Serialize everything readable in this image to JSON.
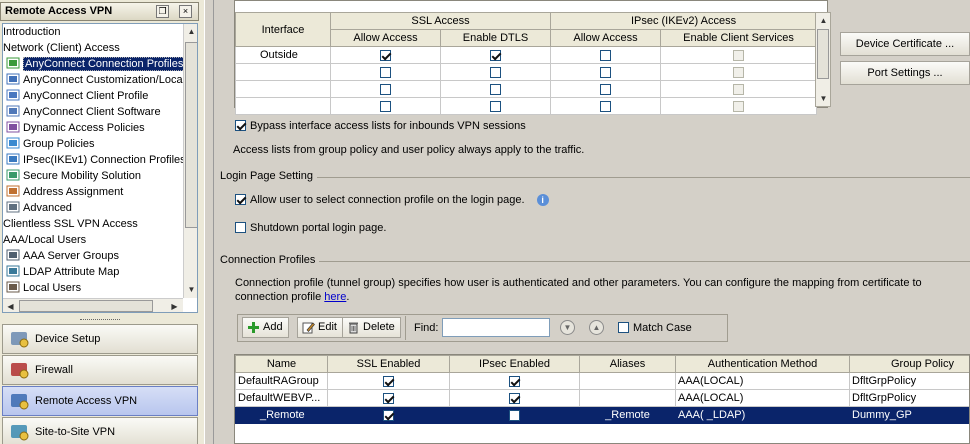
{
  "left": {
    "title": "Remote Access VPN",
    "tree": [
      {
        "label": "Introduction",
        "sub": false
      },
      {
        "label": "Network (Client) Access",
        "sub": false
      },
      {
        "label": "AnyConnect Connection Profiles",
        "sub": true,
        "icon": "profile-icon",
        "selected": true
      },
      {
        "label": "AnyConnect Customization/Localization",
        "sub": true,
        "icon": "customization-icon"
      },
      {
        "label": "AnyConnect Client Profile",
        "sub": true,
        "icon": "client-profile-icon"
      },
      {
        "label": "AnyConnect Client Software",
        "sub": true,
        "icon": "client-software-icon"
      },
      {
        "label": "Dynamic Access Policies",
        "sub": true,
        "icon": "dap-icon"
      },
      {
        "label": "Group Policies",
        "sub": true,
        "icon": "group-policies-icon"
      },
      {
        "label": "IPsec(IKEv1) Connection Profiles",
        "sub": true,
        "icon": "ipsec-icon"
      },
      {
        "label": "Secure Mobility Solution",
        "sub": true,
        "icon": "mobility-icon"
      },
      {
        "label": "Address Assignment",
        "sub": true,
        "icon": "address-icon"
      },
      {
        "label": "Advanced",
        "sub": true,
        "icon": "advanced-icon"
      },
      {
        "label": "Clientless SSL VPN Access",
        "sub": false
      },
      {
        "label": "AAA/Local Users",
        "sub": false
      },
      {
        "label": "AAA Server Groups",
        "sub": true,
        "icon": "server-groups-icon"
      },
      {
        "label": "LDAP Attribute Map",
        "sub": true,
        "icon": "ldap-map-icon"
      },
      {
        "label": "Local Users",
        "sub": true,
        "icon": "local-users-icon"
      }
    ],
    "nav": [
      {
        "label": "Device Setup",
        "icon": "device-setup-icon"
      },
      {
        "label": "Firewall",
        "icon": "firewall-icon"
      },
      {
        "label": "Remote Access VPN",
        "icon": "remote-vpn-icon",
        "active": true
      },
      {
        "label": "Site-to-Site VPN",
        "icon": "site-vpn-icon"
      }
    ]
  },
  "iface_table": {
    "col_interface": "Interface",
    "group_ssl": "SSL Access",
    "group_ipsec": "IPsec (IKEv2) Access",
    "sub_allow": "Allow Access",
    "sub_dtls": "Enable DTLS",
    "sub_allow2": "Allow Access",
    "sub_client": "Enable Client Services",
    "rows": [
      {
        "name": "Outside",
        "ssl_allow": true,
        "dtls": true,
        "ipsec_allow": false,
        "client": false
      },
      {
        "name": "",
        "ssl_allow": false,
        "dtls": false,
        "ipsec_allow": false,
        "client": false
      },
      {
        "name": "",
        "ssl_allow": false,
        "dtls": false,
        "ipsec_allow": false,
        "client": false
      },
      {
        "name": "",
        "ssl_allow": false,
        "dtls": false,
        "ipsec_allow": false,
        "client": false
      }
    ]
  },
  "buttons": {
    "device_cert": "Device Certificate ...",
    "port_settings": "Port Settings ..."
  },
  "bypass_label": "Bypass interface access lists for inbounds VPN sessions",
  "acl_note": "Access lists from group policy and user policy always apply to the traffic.",
  "login_section": "Login Page Setting",
  "allow_select_label": "Allow user to select connection profile on the login page.",
  "shutdown_label": "Shutdown portal login page.",
  "conn_section": "Connection Profiles",
  "conn_desc1": "Connection profile (tunnel group) specifies how user is authenticated and other parameters. You can configure the mapping from certificate to",
  "conn_desc2": "connection profile",
  "conn_link": "here",
  "conn_desc3": ".",
  "toolbar": {
    "add": "Add",
    "edit": "Edit",
    "delete": "Delete",
    "find": "Find:",
    "match_case": "Match Case"
  },
  "profiles": {
    "headers": [
      "Name",
      "SSL Enabled",
      "IPsec Enabled",
      "Aliases",
      "Authentication Method",
      "Group Policy"
    ],
    "rows": [
      {
        "name": "DefaultRAGroup",
        "ssl": true,
        "ipsec": true,
        "aliases": "",
        "auth": "AAA(LOCAL)",
        "policy": "DfltGrpPolicy"
      },
      {
        "name": "DefaultWEBVP...",
        "ssl": true,
        "ipsec": true,
        "aliases": "",
        "auth": "AAA(LOCAL)",
        "policy": "DfltGrpPolicy"
      },
      {
        "name": "_Remote",
        "ssl": true,
        "ipsec": false,
        "aliases": "_Remote",
        "auth": "AAA(      _LDAP)",
        "policy": "Dummy_GP",
        "selected": true
      }
    ]
  }
}
